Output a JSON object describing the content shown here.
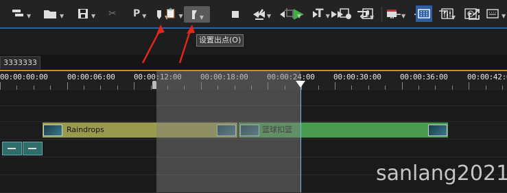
{
  "transport": {
    "in_mark_icon": "mark-in-icon",
    "out_mark_icon": "mark-out-icon",
    "stop_icon": "stop-icon",
    "rewind_icon": "rewind-icon",
    "prev_frame_icon": "previous-frame-icon",
    "play_icon": "play-icon",
    "next_frame_icon": "next-frame-icon",
    "fast_forward_icon": "fast-forward-icon",
    "loop_icon": "loop-icon",
    "accent_color": "#2e5fa0",
    "play_color": "#3cb043"
  },
  "toolbar": {
    "tooltip": "设置出点(O)",
    "p_label": "P",
    "t_label": "T"
  },
  "tabs": [
    "3333333"
  ],
  "ruler": {
    "labels": [
      "00:00:00:00",
      "00:00:06:00",
      "00:00:12:00",
      "00:00:18:00",
      "00:00:24:00",
      "00:00:30:00",
      "00:00:36:00",
      "00:00:42:00"
    ],
    "accent_color": "#e08a1e"
  },
  "clips": {
    "raindrops": {
      "label": "Raindrops",
      "color": "#9a9a4e"
    },
    "basketball": {
      "label": "篮球扣篮",
      "color": "#4a9a4f"
    }
  },
  "watermark": "sanlang2021",
  "playhead_color": "#6fc0e8"
}
